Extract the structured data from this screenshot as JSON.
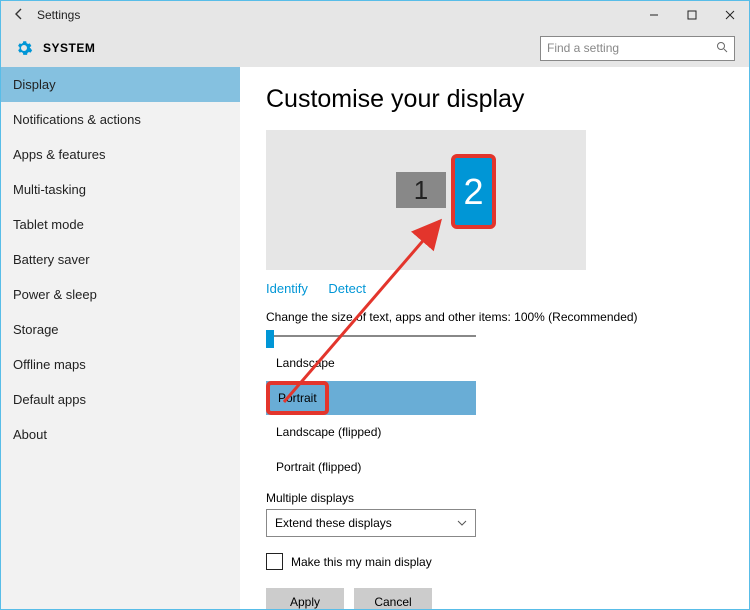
{
  "window": {
    "title": "Settings"
  },
  "header": {
    "crumb": "SYSTEM",
    "search_placeholder": "Find a setting"
  },
  "sidebar": {
    "items": [
      "Display",
      "Notifications & actions",
      "Apps & features",
      "Multi-tasking",
      "Tablet mode",
      "Battery saver",
      "Power & sleep",
      "Storage",
      "Offline maps",
      "Default apps",
      "About"
    ],
    "active_index": 0
  },
  "content": {
    "heading": "Customise your display",
    "monitors": {
      "m1": "1",
      "m2": "2",
      "selected": 2
    },
    "links": {
      "identify": "Identify",
      "detect": "Detect"
    },
    "size_text": "Change the size of text, apps and other items: 100% (Recommended)",
    "orientation_options": [
      "Landscape",
      "Portrait",
      "Landscape (flipped)",
      "Portrait (flipped)"
    ],
    "orientation_selected_index": 1,
    "multi_label": "Multiple displays",
    "multi_value": "Extend these displays",
    "main_display_label": "Make this my main display",
    "main_display_checked": false,
    "apply": "Apply",
    "cancel": "Cancel"
  }
}
